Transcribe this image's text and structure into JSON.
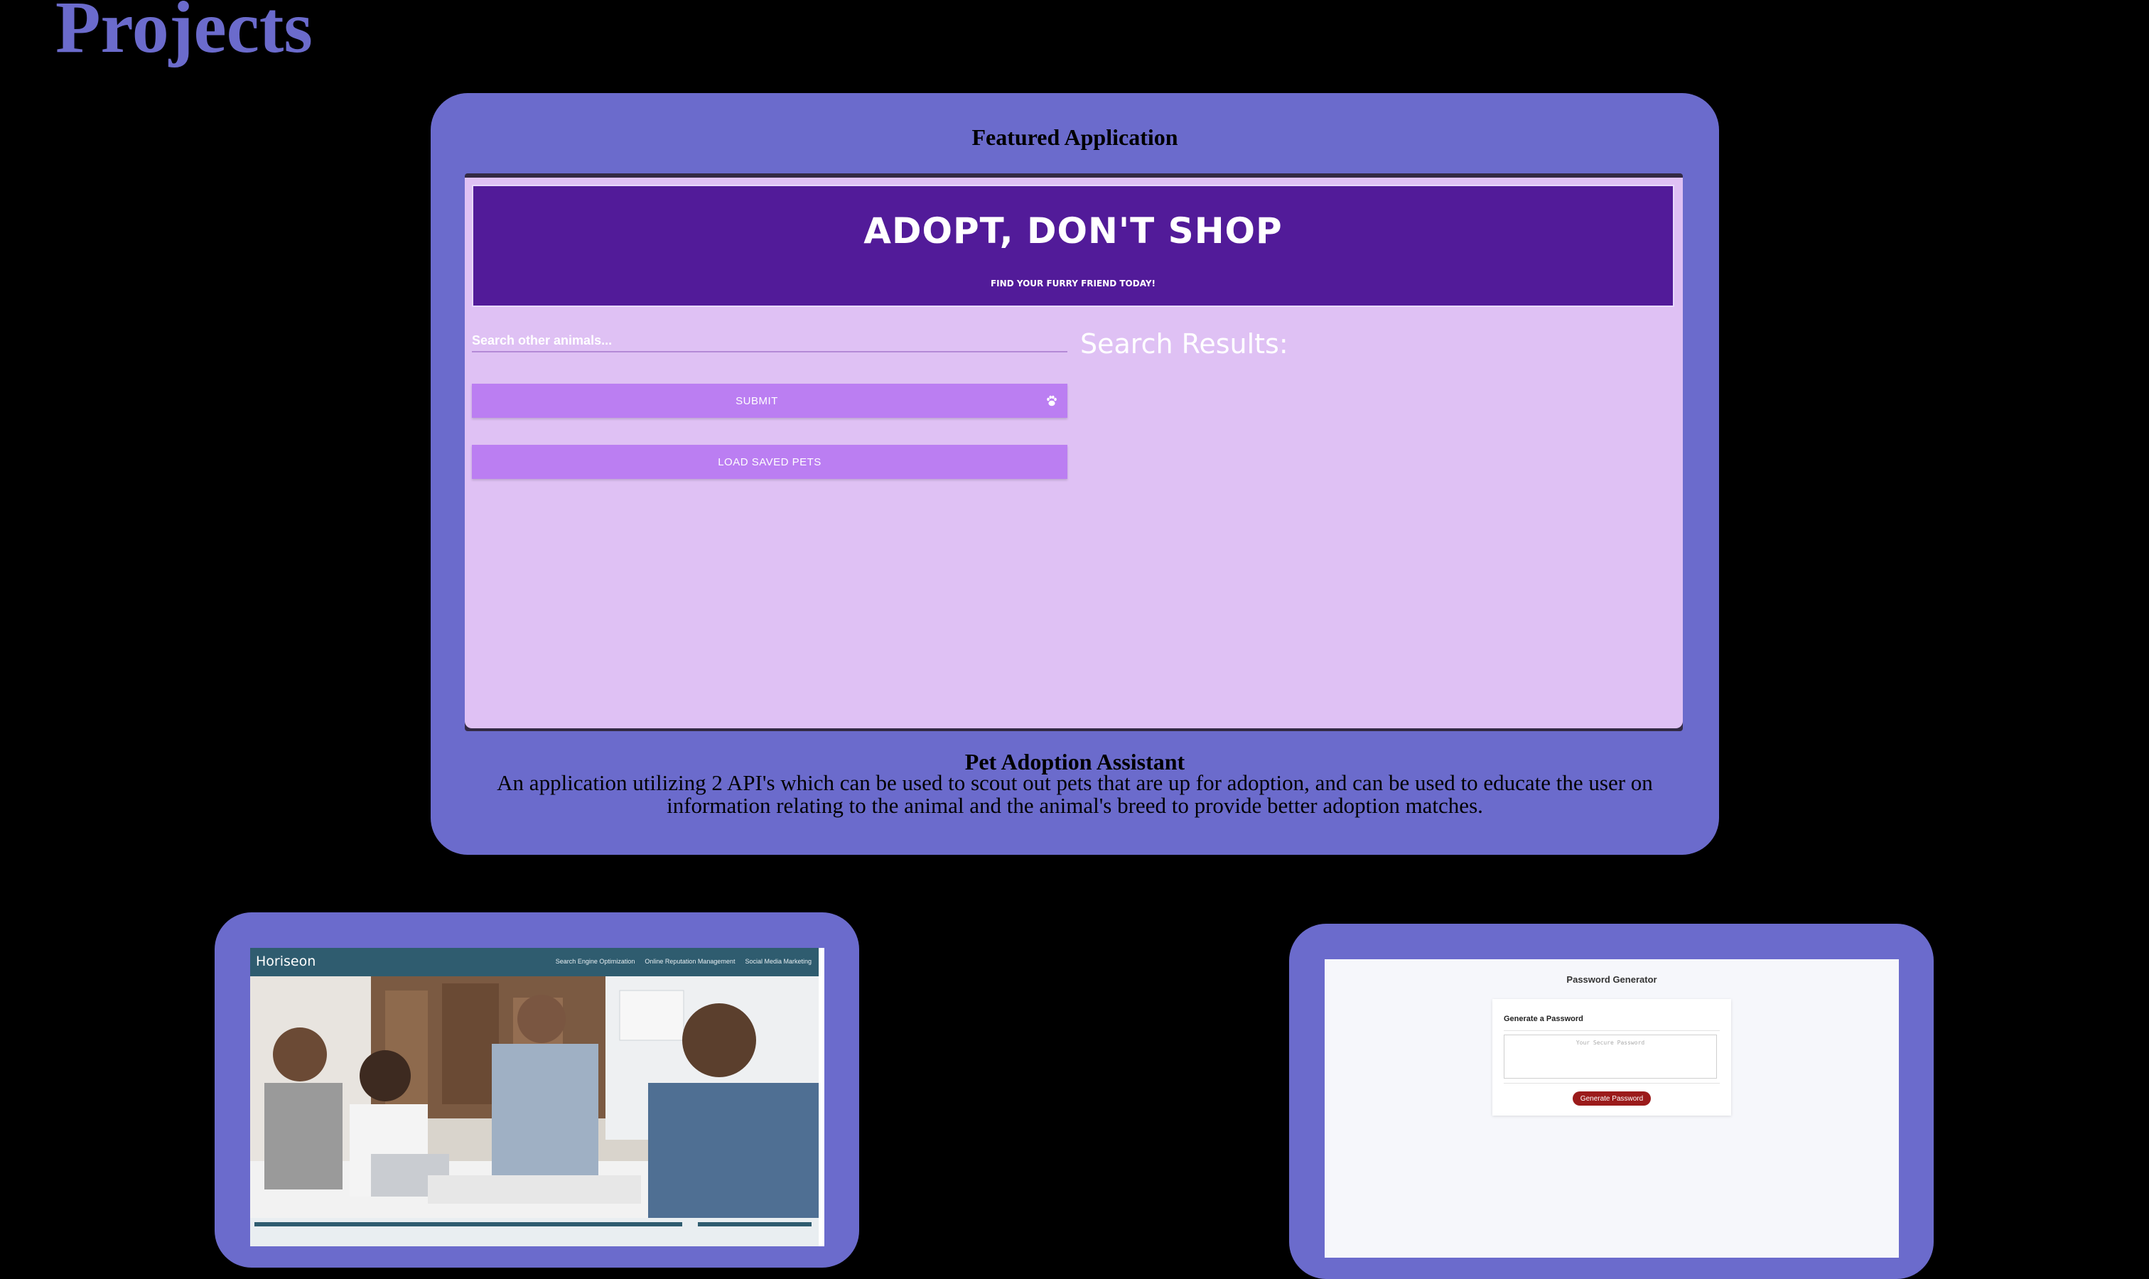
{
  "page": {
    "title": "Projects"
  },
  "featured": {
    "heading": "Featured Application",
    "screenshot": {
      "title": "ADOPT, DON'T SHOP",
      "subtitle": "Find your furry friend today!",
      "search_placeholder": "Search other animals...",
      "submit_label": "SUBMIT",
      "load_label": "LOAD SAVED PETS",
      "results_label": "Search Results:"
    },
    "name": "Pet Adoption Assistant",
    "description": "An application utilizing 2 API's which can be used to scout out pets that are up for adoption, and can be used to educate the user on information relating to the animal and the animal's breed to provide better adoption matches."
  },
  "projects": [
    {
      "screenshot": {
        "logo": "Horiseon",
        "nav": [
          "Search Engine Optimization",
          "Online Reputation Management",
          "Social Media Marketing"
        ]
      }
    },
    {
      "screenshot": {
        "title": "Password Generator",
        "card_heading": "Generate a Password",
        "placeholder": "Your Secure Password",
        "button_label": "Generate Password"
      }
    }
  ],
  "colors": {
    "background": "#000000",
    "card": "#6b6bcc",
    "pet_header": "#521b99",
    "pet_body": "#dfc1f4",
    "pet_button": "#bb7ef2",
    "horiseon_header": "#2f5c6f",
    "password_button": "#9b1b1b"
  },
  "icons": [
    "paw-icon"
  ]
}
